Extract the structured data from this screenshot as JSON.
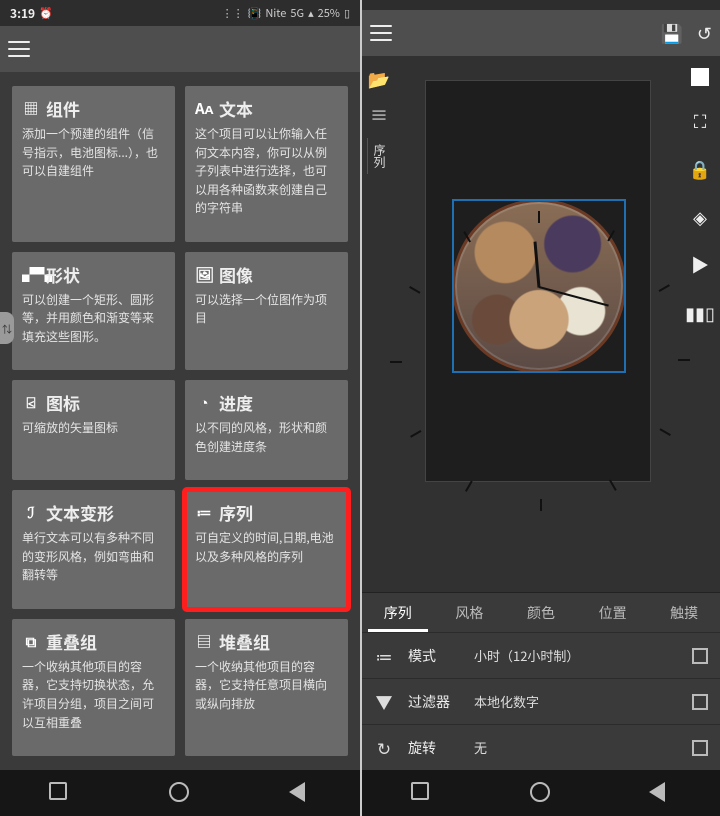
{
  "status": {
    "time": "3:19",
    "alarm": "⏰",
    "bt": "⋮⋮",
    "vib": "📳",
    "net": "Nite",
    "sig": "5G",
    "wifi": "▴",
    "batt": "25%"
  },
  "edge_glyph": "⇅",
  "left": {
    "cards": [
      {
        "icon": "▦",
        "title": "组件",
        "desc": "添加一个预建的组件（信号指示，电池图标...），也可以自建组件"
      },
      {
        "icon": "Aᴀ",
        "title": "文本",
        "desc": "这个项目可以让你输入任何文本内容，你可以从例子列表中进行选择，也可以用各种函数来创建自己的字符串"
      },
      {
        "icon": "▞▚",
        "title": "形状",
        "desc": "可以创建一个矩形、圆形等，并用颜色和渐变等来填充这些图形。"
      },
      {
        "icon": "🖼",
        "title": "图像",
        "desc": "可以选择一个位图作为项目"
      },
      {
        "icon": "⍃",
        "title": "图标",
        "desc": "可缩放的矢量图标"
      },
      {
        "icon": "◔",
        "title": "进度",
        "desc": "以不同的风格，形状和颜色创建进度条"
      },
      {
        "icon": "ℐ",
        "title": "文本变形",
        "desc": "单行文本可以有多种不同的变形风格，例如弯曲和翻转等"
      },
      {
        "icon": "≔",
        "title": "序列",
        "desc": "可自定义的时间,日期,电池以及多种风格的序列"
      },
      {
        "icon": "⧉",
        "title": "重叠组",
        "desc": "一个收纳其他项目的容器，它支持切换状态，允许项目分组，项目之间可以互相重叠"
      },
      {
        "icon": "▤",
        "title": "堆叠组",
        "desc": "一个收纳其他项目的容器，它支持任意项目横向或纵向排放"
      }
    ],
    "highlight_index": 7
  },
  "right": {
    "toolbar_icons": {
      "save": "💾",
      "history": "↺"
    },
    "left_rail": {
      "folder": "📂",
      "menu": "≡",
      "label": "序列"
    },
    "right_rail": [
      "sw",
      "⛶",
      "🔒",
      "◈",
      "▶",
      "▮▮▯"
    ],
    "tabs": [
      "序列",
      "风格",
      "颜色",
      "位置",
      "触摸"
    ],
    "active_tab": 0,
    "props": [
      {
        "icon": "≔",
        "label": "模式",
        "value": "小时（12小时制）"
      },
      {
        "icon": "▼",
        "label": "过滤器",
        "value": "本地化数字"
      },
      {
        "icon": "↻",
        "label": "旋转",
        "value": "无"
      }
    ]
  }
}
